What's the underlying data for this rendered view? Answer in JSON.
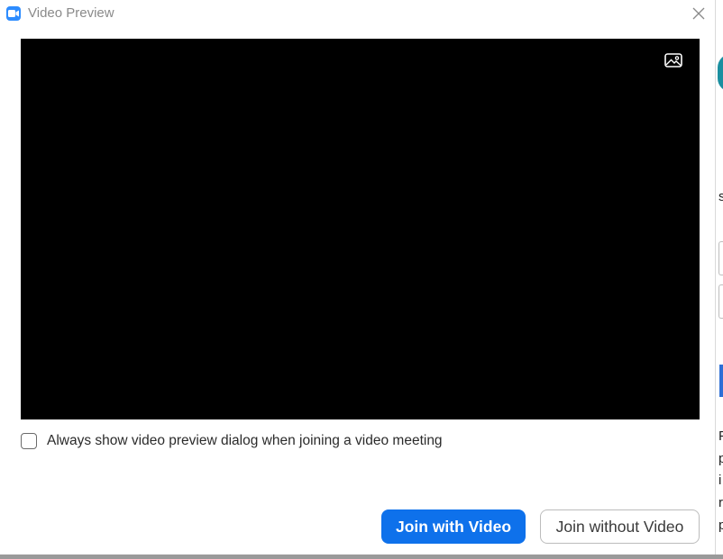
{
  "window": {
    "title": "Video Preview",
    "app_icon": "zoom-camera-icon",
    "close_icon": "close-icon"
  },
  "video": {
    "background_color": "#000000",
    "toggle_icon": "virtual-background-icon"
  },
  "preference": {
    "checkbox_label": "Always show video preview dialog when joining a video meeting",
    "checked": false
  },
  "buttons": {
    "join_with_video": "Join with Video",
    "join_without_video": "Join without Video"
  },
  "colors": {
    "accent": "#0e71eb",
    "app_icon": "#2d8cff"
  },
  "background_app": {
    "fragments": [
      "s",
      "F",
      "p",
      "i",
      "r",
      "p"
    ]
  }
}
